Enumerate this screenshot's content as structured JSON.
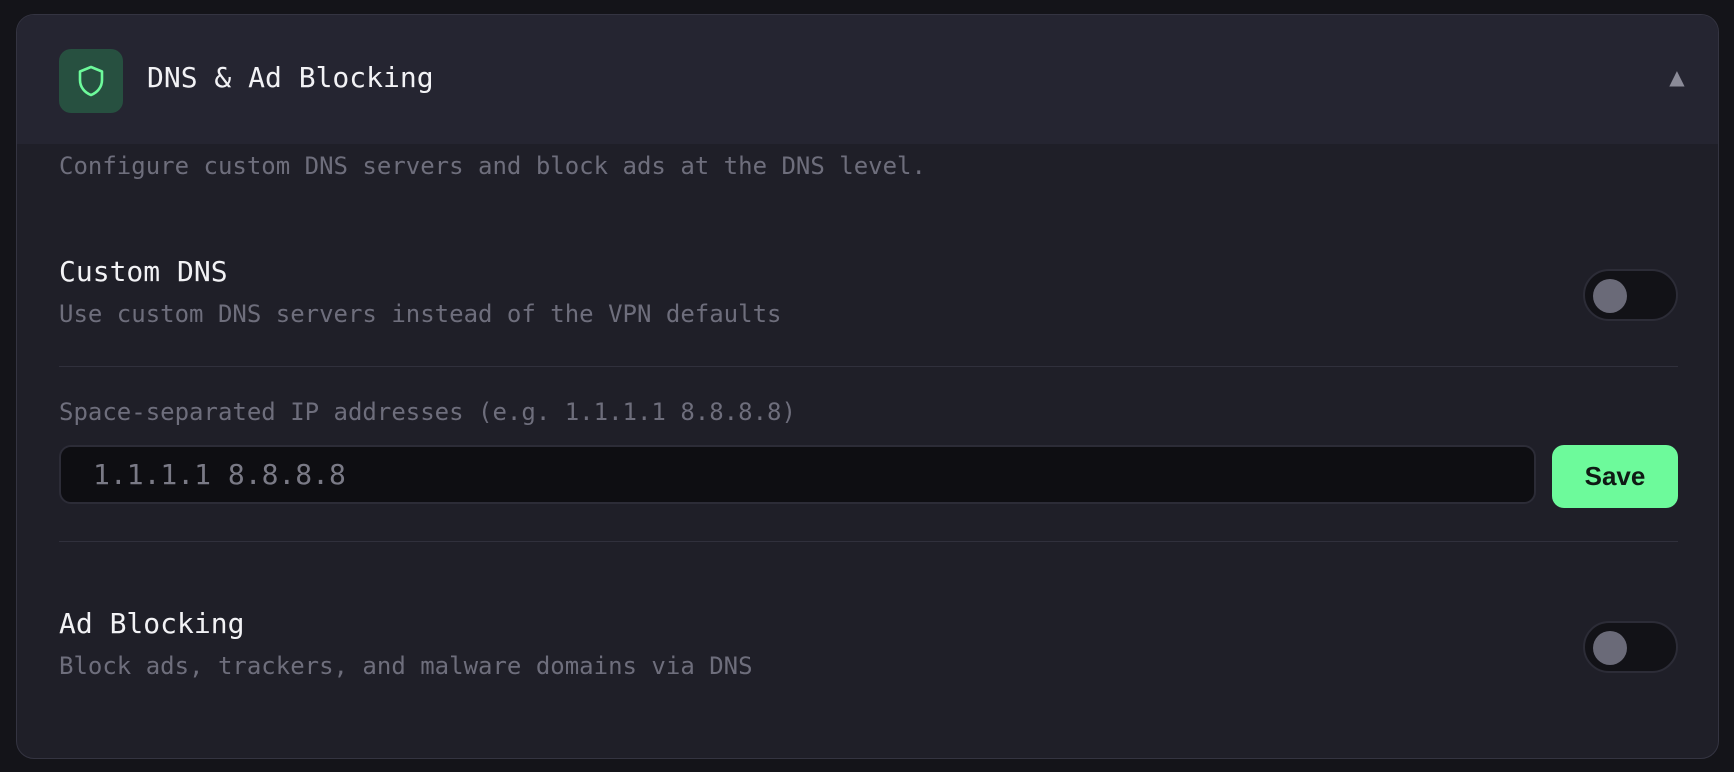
{
  "section": {
    "title": "DNS & Ad Blocking",
    "collapse_glyph": "▲",
    "description": "Configure custom DNS servers and block ads at the DNS level.",
    "icon": "shield-icon",
    "icon_color": "#6dfa9b",
    "accent": "#6dfa9b"
  },
  "custom_dns": {
    "title": "Custom DNS",
    "description": "Use custom DNS servers instead of the VPN defaults",
    "enabled": false,
    "field_label": "Space-separated IP addresses (e.g. 1.1.1.1 8.8.8.8)",
    "input_value": "",
    "input_placeholder": "1.1.1.1 8.8.8.8",
    "save_label": "Save"
  },
  "ad_blocking": {
    "title": "Ad Blocking",
    "description": "Block ads, trackers, and malware domains via DNS",
    "enabled": false
  }
}
